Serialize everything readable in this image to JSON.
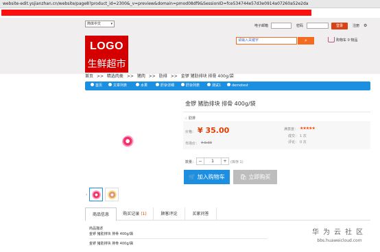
{
  "browser": {
    "url": "website-edit.ysjianzhan.cn/website/page8?product_id=2300&_v=preview&domain=pmod08df9&SessionID=fce534744e57d3e0914a07260a52e2da"
  },
  "header": {
    "language": "简体中文",
    "email_label": "电子邮箱",
    "password_label": "密码",
    "login_button": "登录",
    "register_link": "注册",
    "logo_line1": "LOGO",
    "logo_line2": "生鲜超市",
    "search_placeholder": "请输入关键字",
    "search_icon": "search-icon",
    "cart_label": "购物车 0 物品"
  },
  "breadcrumb": [
    "首页",
    ">>",
    "精选肉类",
    ">>",
    "猪肉",
    ">>",
    "肋排",
    ">>",
    "金锣 猪肋排块 排骨 400g/袋"
  ],
  "nav": [
    "首页",
    "文章列表",
    "水果",
    "肝杂详细",
    "肝杂列表",
    "测试1",
    "demotest"
  ],
  "product": {
    "title": "金锣 猪肋排块 排骨 400g/袋",
    "unit": "：肋排",
    "price_label": "价格：",
    "price": "¥ 35.00",
    "market_label": "市场价：",
    "market_price": "¥ 0.00",
    "rating_label": "满意度：",
    "stars": "★★★★★",
    "deals_label": "成交：",
    "deals_value": "1 次",
    "reviews_label": "评论：",
    "reviews_value": "0 次",
    "qty_label": "数量：",
    "qty_minus": "−",
    "qty_value": "1",
    "qty_plus": "+",
    "stock": "(库存 1)",
    "add_cart": "加入购物车",
    "buy_now": "立即购买"
  },
  "tabs": [
    {
      "label": "商品信息"
    },
    {
      "label": "购买记录",
      "count": "(1)"
    },
    {
      "label": "顾客评论"
    },
    {
      "label": "买家问答"
    }
  ],
  "description": {
    "heading": "商品描述",
    "line1": "金锣 猪肋排块 排骨 400g/袋",
    "line2": "金锣 猪肋排块 排骨 400g/袋"
  },
  "watermark": {
    "line1": "华为云社区",
    "line2": "bbs.huaweicloud.com"
  },
  "colors": {
    "brand_red": "#d40000",
    "nav_blue": "#1d8fe1",
    "price_orange": "#e43b00",
    "search_orange": "#f26b21"
  }
}
